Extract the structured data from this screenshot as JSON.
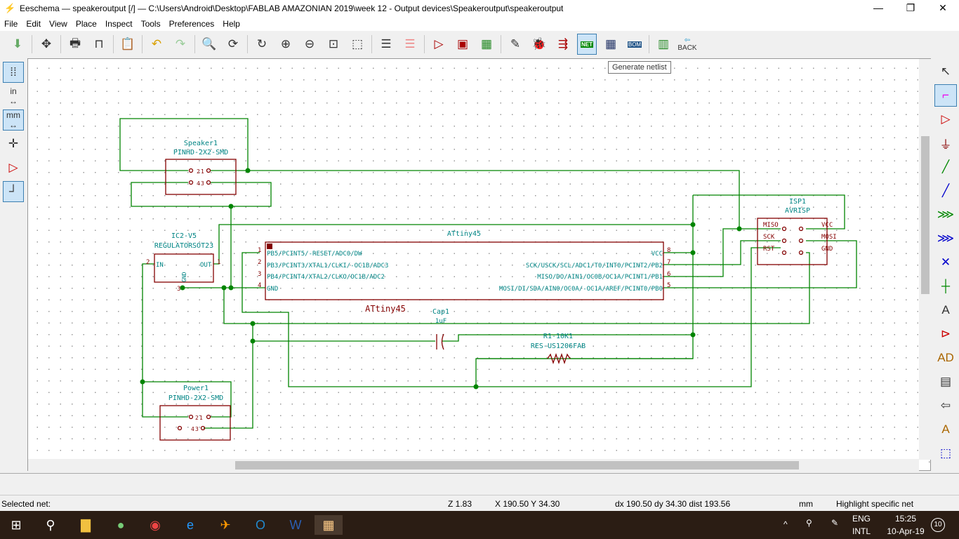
{
  "window": {
    "title": "Eeschema — speakeroutput [/] — C:\\Users\\Android\\Desktop\\FABLAB AMAZONIAN 2019\\week 12 - Output devices\\Speakeroutput\\speakeroutput",
    "minimize": "—",
    "maximize": "❐",
    "close": "✕"
  },
  "menu": [
    "File",
    "Edit",
    "View",
    "Place",
    "Inspect",
    "Tools",
    "Preferences",
    "Help"
  ],
  "toolbar": {
    "back_label": "BACK",
    "net_label": "NET",
    "bom_label": "BOM",
    "tooltip": "Generate netlist"
  },
  "left_toolbar": {
    "in_label": "in",
    "mm_label": "mm"
  },
  "schematic": {
    "speaker": {
      "ref": "Speaker1",
      "value": "PINHD-2X2-SMD",
      "pins": [
        "2",
        "1",
        "4",
        "3"
      ]
    },
    "power": {
      "ref": "Power1",
      "value": "PINHD-2X2-SMD",
      "pins": [
        "2",
        "1",
        "4",
        "3"
      ]
    },
    "regulator": {
      "ref": "IC2-V5",
      "value": "REGULATORSOT23",
      "pin_in": "IN",
      "pin_out": "OUT",
      "pin_gnd": "GND",
      "num_in": "2",
      "num_out": "1",
      "num_gnd": "3"
    },
    "attiny": {
      "ref": "ATtiny45",
      "value": "ATtiny45",
      "left_pins": [
        {
          "num": "1",
          "name": "PB5/PCINT5/-RESET/ADC0/DW"
        },
        {
          "num": "2",
          "name": "PB3/PCINT3/XTAL1/CLKI/-OC1B/ADC3"
        },
        {
          "num": "3",
          "name": "PB4/PCINT4/XTAL2/CLKO/OC1B/ADC2"
        },
        {
          "num": "4",
          "name": "GND"
        }
      ],
      "right_pins": [
        {
          "num": "8",
          "name": "VCC"
        },
        {
          "num": "7",
          "name": "SCK/USCK/SCL/ADC1/T0/INT0/PCINT2/PB2"
        },
        {
          "num": "6",
          "name": "MISO/DO/AIN1/OC0B/OC1A/PCINT1/PB1"
        },
        {
          "num": "5",
          "name": "MOSI/DI/SDA/AIN0/OC0A/-OC1A/AREF/PCINT0/PB0"
        }
      ]
    },
    "isp": {
      "ref": "ISP1",
      "value": "AVRISP",
      "left": [
        "MISO",
        "SCK",
        "RST"
      ],
      "right": [
        "VCC",
        "MOSI",
        "GND"
      ]
    },
    "cap": {
      "ref": "Cap1",
      "value": "1uF"
    },
    "resistor": {
      "ref": "R1-10K1",
      "value": "RES-US1206FAB"
    }
  },
  "status": {
    "selected_net": "Selected net:",
    "zoom": "Z 1.83",
    "xy": "X 190.50  Y 34.30",
    "delta": "dx 190.50  dy 34.30  dist 193.56",
    "units": "mm",
    "mode": "Highlight specific net"
  },
  "taskbar": {
    "lang1": "ENG",
    "lang2": "INTL",
    "time": "15:25",
    "date": "10-Apr-19",
    "notifications": "10"
  },
  "colors": {
    "wire": "#008400",
    "component": "#840000",
    "text": "#008484",
    "ref": "#840000"
  }
}
